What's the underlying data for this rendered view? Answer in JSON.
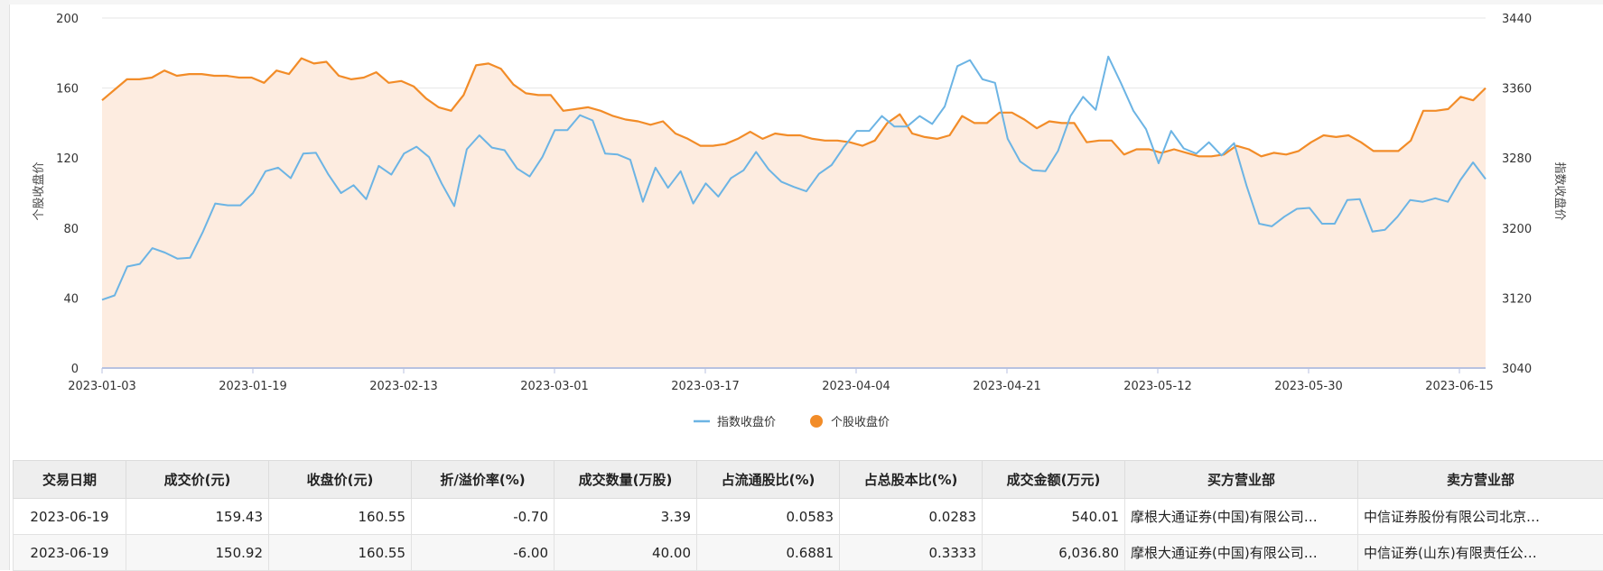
{
  "chart_data": {
    "type": "line",
    "x_tick_labels": [
      "2023-01-03",
      "2023-01-19",
      "2023-02-13",
      "2023-03-01",
      "2023-03-17",
      "2023-04-04",
      "2023-04-21",
      "2023-05-12",
      "2023-05-30",
      "2023-06-15"
    ],
    "y_left_ticks": [
      "0",
      "40",
      "80",
      "120",
      "160",
      "200"
    ],
    "y_right_ticks": [
      "3040",
      "3120",
      "3200",
      "3280",
      "3360",
      "3440"
    ],
    "ylabel_left": "个股收盘价",
    "ylabel_right": "指数收盘价",
    "ylim_left": [
      0,
      200
    ],
    "ylim_right": [
      3040,
      3440
    ],
    "grid": true,
    "legend_position": "bottom-center",
    "series": [
      {
        "name": "指数收盘价",
        "axis": "right",
        "color": "#6cb4e4",
        "values": [
          3118,
          3123,
          3156,
          3159,
          3177,
          3172,
          3165,
          3166,
          3195,
          3228,
          3226,
          3226,
          3240,
          3265,
          3269,
          3257,
          3285,
          3286,
          3261,
          3240,
          3249,
          3233,
          3271,
          3261,
          3285,
          3293,
          3281,
          3251,
          3225,
          3290,
          3306,
          3292,
          3289,
          3268,
          3259,
          3281,
          3312,
          3312,
          3329,
          3323,
          3285,
          3284,
          3278,
          3230,
          3269,
          3246,
          3265,
          3228,
          3251,
          3236,
          3257,
          3266,
          3287,
          3267,
          3253,
          3247,
          3242,
          3262,
          3272,
          3293,
          3311,
          3311,
          3328,
          3316,
          3316,
          3328,
          3319,
          3339,
          3385,
          3392,
          3370,
          3366,
          3302,
          3276,
          3266,
          3265,
          3288,
          3328,
          3350,
          3335,
          3396,
          3366,
          3334,
          3313,
          3274,
          3311,
          3291,
          3285,
          3298,
          3283,
          3297,
          3248,
          3205,
          3202,
          3213,
          3222,
          3223,
          3205,
          3205,
          3232,
          3233,
          3196,
          3198,
          3213,
          3232,
          3230,
          3234,
          3230,
          3255,
          3275,
          3256
        ]
      },
      {
        "name": "个股收盘价",
        "axis": "left",
        "color": "#f28c28",
        "values": [
          153,
          159,
          165,
          165,
          166,
          170,
          167,
          168,
          168,
          167,
          167,
          166,
          166,
          163,
          170,
          168,
          177,
          174,
          175,
          167,
          165,
          166,
          169,
          163,
          164,
          161,
          154,
          149,
          147,
          156,
          173,
          174,
          171,
          162,
          157,
          156,
          156,
          147,
          148,
          149,
          147,
          144,
          142,
          141,
          139,
          141,
          134,
          131,
          127,
          127,
          128,
          131,
          135,
          131,
          134,
          133,
          133,
          131,
          130,
          130,
          129,
          127,
          130,
          140,
          145,
          134,
          132,
          131,
          133,
          144,
          140,
          140,
          146,
          146,
          142,
          137,
          141,
          140,
          140,
          129,
          130,
          130,
          122,
          125,
          125,
          123,
          125,
          123,
          121,
          121,
          122,
          127,
          125,
          121,
          123,
          122,
          124,
          129,
          133,
          132,
          133,
          129,
          124,
          124,
          124,
          130,
          147,
          147,
          148,
          155,
          153,
          160
        ]
      }
    ]
  },
  "table": {
    "headers": [
      "交易日期",
      "成交价(元)",
      "收盘价(元)",
      "折/溢价率(%)",
      "成交数量(万股)",
      "占流通股比(%)",
      "占总股本比(%)",
      "成交金额(万元)",
      "买方营业部",
      "卖方营业部"
    ],
    "rows": [
      [
        "2023-06-19",
        "159.43",
        "160.55",
        "-0.70",
        "3.39",
        "0.0583",
        "0.0283",
        "540.01",
        "摩根大通证券(中国)有限公司…",
        "中信证券股份有限公司北京…"
      ],
      [
        "2023-06-19",
        "150.92",
        "160.55",
        "-6.00",
        "40.00",
        "0.6881",
        "0.3333",
        "6,036.80",
        "摩根大通证券(中国)有限公司…",
        "中信证券(山东)有限责任公…"
      ]
    ]
  }
}
